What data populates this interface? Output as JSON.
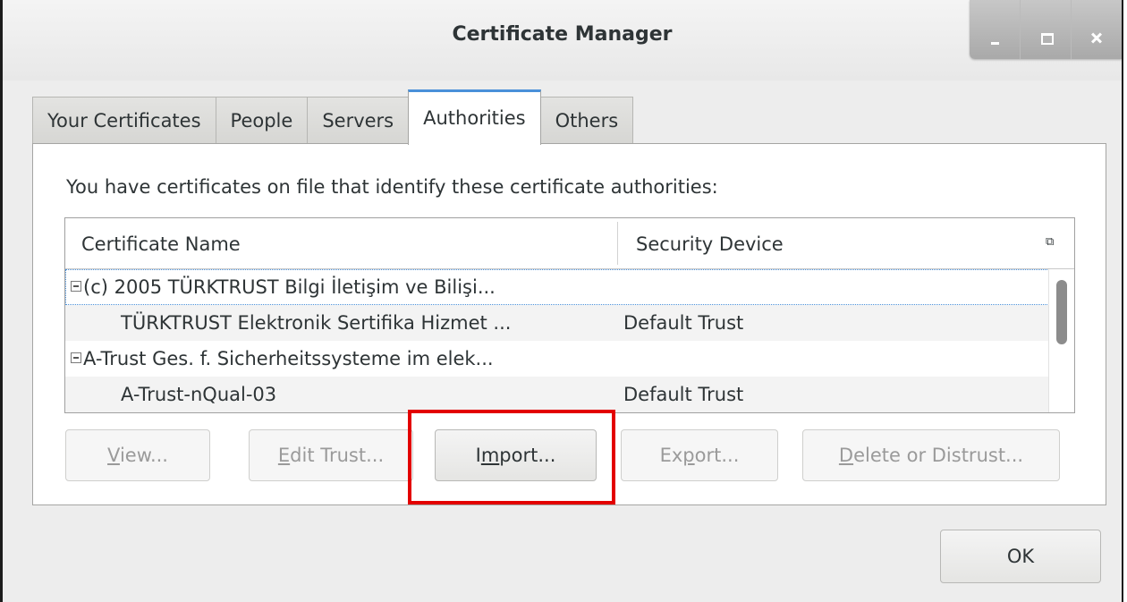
{
  "window": {
    "title": "Certificate Manager"
  },
  "tabs": [
    {
      "label": "Your Certificates",
      "active": false
    },
    {
      "label": "People",
      "active": false
    },
    {
      "label": "Servers",
      "active": false
    },
    {
      "label": "Authorities",
      "active": true
    },
    {
      "label": "Others",
      "active": false
    }
  ],
  "intro_text": "You have certificates on file that identify these certificate authorities:",
  "table": {
    "columns": [
      "Certificate Name",
      "Security Device"
    ],
    "rows": [
      {
        "name": "(c) 2005 TÜRKTRUST Bilgi İletişim ve Bilişi...",
        "device": "",
        "group": true
      },
      {
        "name": "TÜRKTRUST Elektronik Sertifika Hizmet ...",
        "device": "Default Trust",
        "group": false
      },
      {
        "name": "A-Trust Ges. f. Sicherheitssysteme im elek...",
        "device": "",
        "group": true
      },
      {
        "name": "A-Trust-nQual-03",
        "device": "Default Trust",
        "group": false
      }
    ]
  },
  "buttons": {
    "view": {
      "pre": "",
      "accel": "V",
      "post": "iew..."
    },
    "edit_trust": {
      "pre": "",
      "accel": "E",
      "post": "dit Trust..."
    },
    "import": {
      "pre": "I",
      "accel": "m",
      "post": "port..."
    },
    "export": {
      "pre": "Ex",
      "accel": "p",
      "post": "ort..."
    },
    "delete": {
      "pre": "",
      "accel": "D",
      "post": "elete or Distrust..."
    },
    "ok": "OK"
  },
  "colors": {
    "highlight": "#e30000",
    "active_tab_accent": "#4a90d9"
  }
}
